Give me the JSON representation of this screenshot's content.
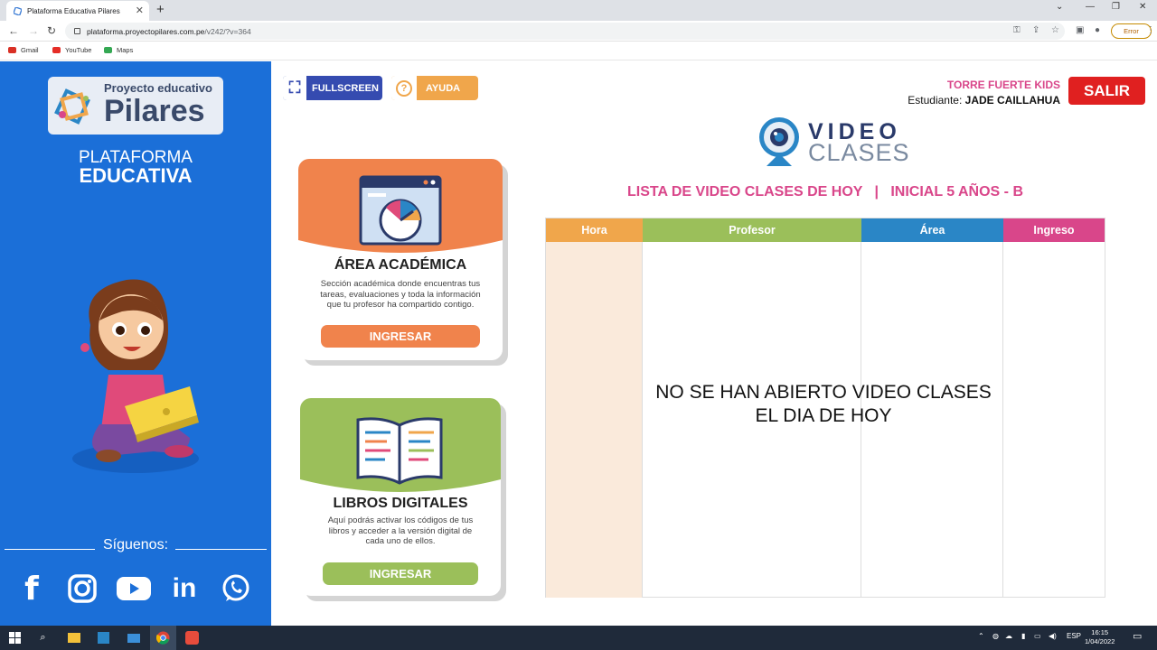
{
  "browser": {
    "tab_title": "Plataforma Educativa Pilares",
    "new_tab": "+",
    "url_host": "plataforma.proyectopilares.com.pe",
    "url_path": "/v242/?v=364",
    "profile_status": "Error",
    "bookmarks": [
      {
        "label": "Gmail",
        "color": "#d93025"
      },
      {
        "label": "YouTube",
        "color": "#e52d27"
      },
      {
        "label": "Maps",
        "color": "#34a853"
      }
    ]
  },
  "sidebar": {
    "logo_small": "Proyecto educativo",
    "logo_big": "Pilares",
    "platform_line1": "PLATAFORMA",
    "platform_line2": "EDUCATIVA",
    "follow_label": "Síguenos:",
    "social": [
      "facebook-icon",
      "instagram-icon",
      "youtube-icon",
      "linkedin-icon",
      "whatsapp-icon"
    ]
  },
  "toolbar": {
    "fullscreen_label": "FULLSCREEN",
    "help_label": "AYUDA"
  },
  "user": {
    "school": "TORRE FUERTE KIDS",
    "student_prefix": "Estudiante:",
    "student_name": "JADE CAILLAHUA",
    "logout_label": "SALIR"
  },
  "video_logo": {
    "line1": "VIDEO",
    "line2": "CLASES"
  },
  "list_title": "LISTA DE VIDEO CLASES DE HOY   |   INICIAL 5 AÑOS - B",
  "cards": [
    {
      "title": "ÁREA ACADÉMICA",
      "description": "Sección académica donde encuentras tus tareas, evaluaciones y toda la información que tu profesor ha compartido contigo.",
      "button": "INGRESAR",
      "color": "#f0834c"
    },
    {
      "title": "LIBROS DIGITALES",
      "description": "Aquí podrás activar los códigos de tus libros y acceder a la versión digital de cada uno de ellos.",
      "button": "INGRESAR",
      "color": "#9bbf5a"
    }
  ],
  "table": {
    "columns": [
      {
        "label": "Hora",
        "color": "#f0a64b"
      },
      {
        "label": "Profesor",
        "color": "#9bbf5a"
      },
      {
        "label": "Área",
        "color": "#2a86c6"
      },
      {
        "label": "Ingreso",
        "color": "#d9468a"
      }
    ],
    "empty_line1": "NO SE HAN ABIERTO VIDEO CLASES",
    "empty_line2": "EL DIA DE HOY"
  },
  "taskbar": {
    "language": "ESP",
    "time": "16:15",
    "date": "1/04/2022"
  }
}
